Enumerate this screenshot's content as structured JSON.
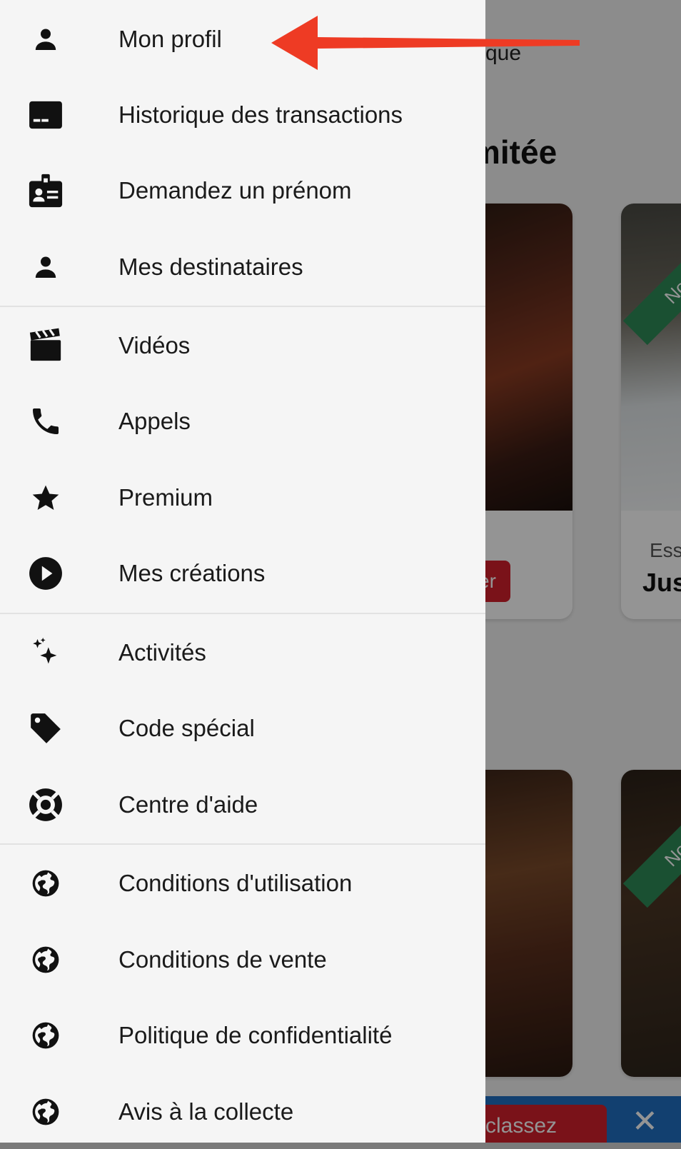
{
  "background": {
    "subtitle_fragment": "que",
    "heading_fragment": "mitée",
    "card1": {
      "button_fragment": "er"
    },
    "card2": {
      "ribbon": "Nouv",
      "caption_small": "Ess",
      "caption_big": "Jus"
    },
    "card4": {
      "ribbon": "Nouv"
    },
    "banner": {
      "cta_fragment": "classez",
      "close": "✕"
    }
  },
  "drawer": {
    "items": [
      {
        "label": "Mon profil",
        "icon": "person-icon"
      },
      {
        "label": "Historique des transactions",
        "icon": "card-icon"
      },
      {
        "label": "Demandez un prénom",
        "icon": "badge-icon"
      },
      {
        "label": "Mes destinataires",
        "icon": "person-icon"
      },
      {
        "label": "Vidéos",
        "icon": "clapperboard-icon"
      },
      {
        "label": "Appels",
        "icon": "phone-icon"
      },
      {
        "label": "Premium",
        "icon": "star-icon"
      },
      {
        "label": "Mes créations",
        "icon": "play-circle-icon"
      },
      {
        "label": "Activités",
        "icon": "sparkles-icon"
      },
      {
        "label": "Code spécial",
        "icon": "tag-icon"
      },
      {
        "label": "Centre d'aide",
        "icon": "lifebuoy-icon"
      },
      {
        "label": "Conditions d'utilisation",
        "icon": "globe-icon"
      },
      {
        "label": "Conditions de vente",
        "icon": "globe-icon"
      },
      {
        "label": "Politique de confidentialité",
        "icon": "globe-icon"
      },
      {
        "label": "Avis à la collecte",
        "icon": "globe-icon"
      }
    ]
  },
  "colors": {
    "drawer_bg": "#f5f5f5",
    "icon": "#111111",
    "annotation_arrow": "#ee3b24",
    "ribbon_green": "#2e8b57",
    "brand_red": "#d21f2b"
  }
}
